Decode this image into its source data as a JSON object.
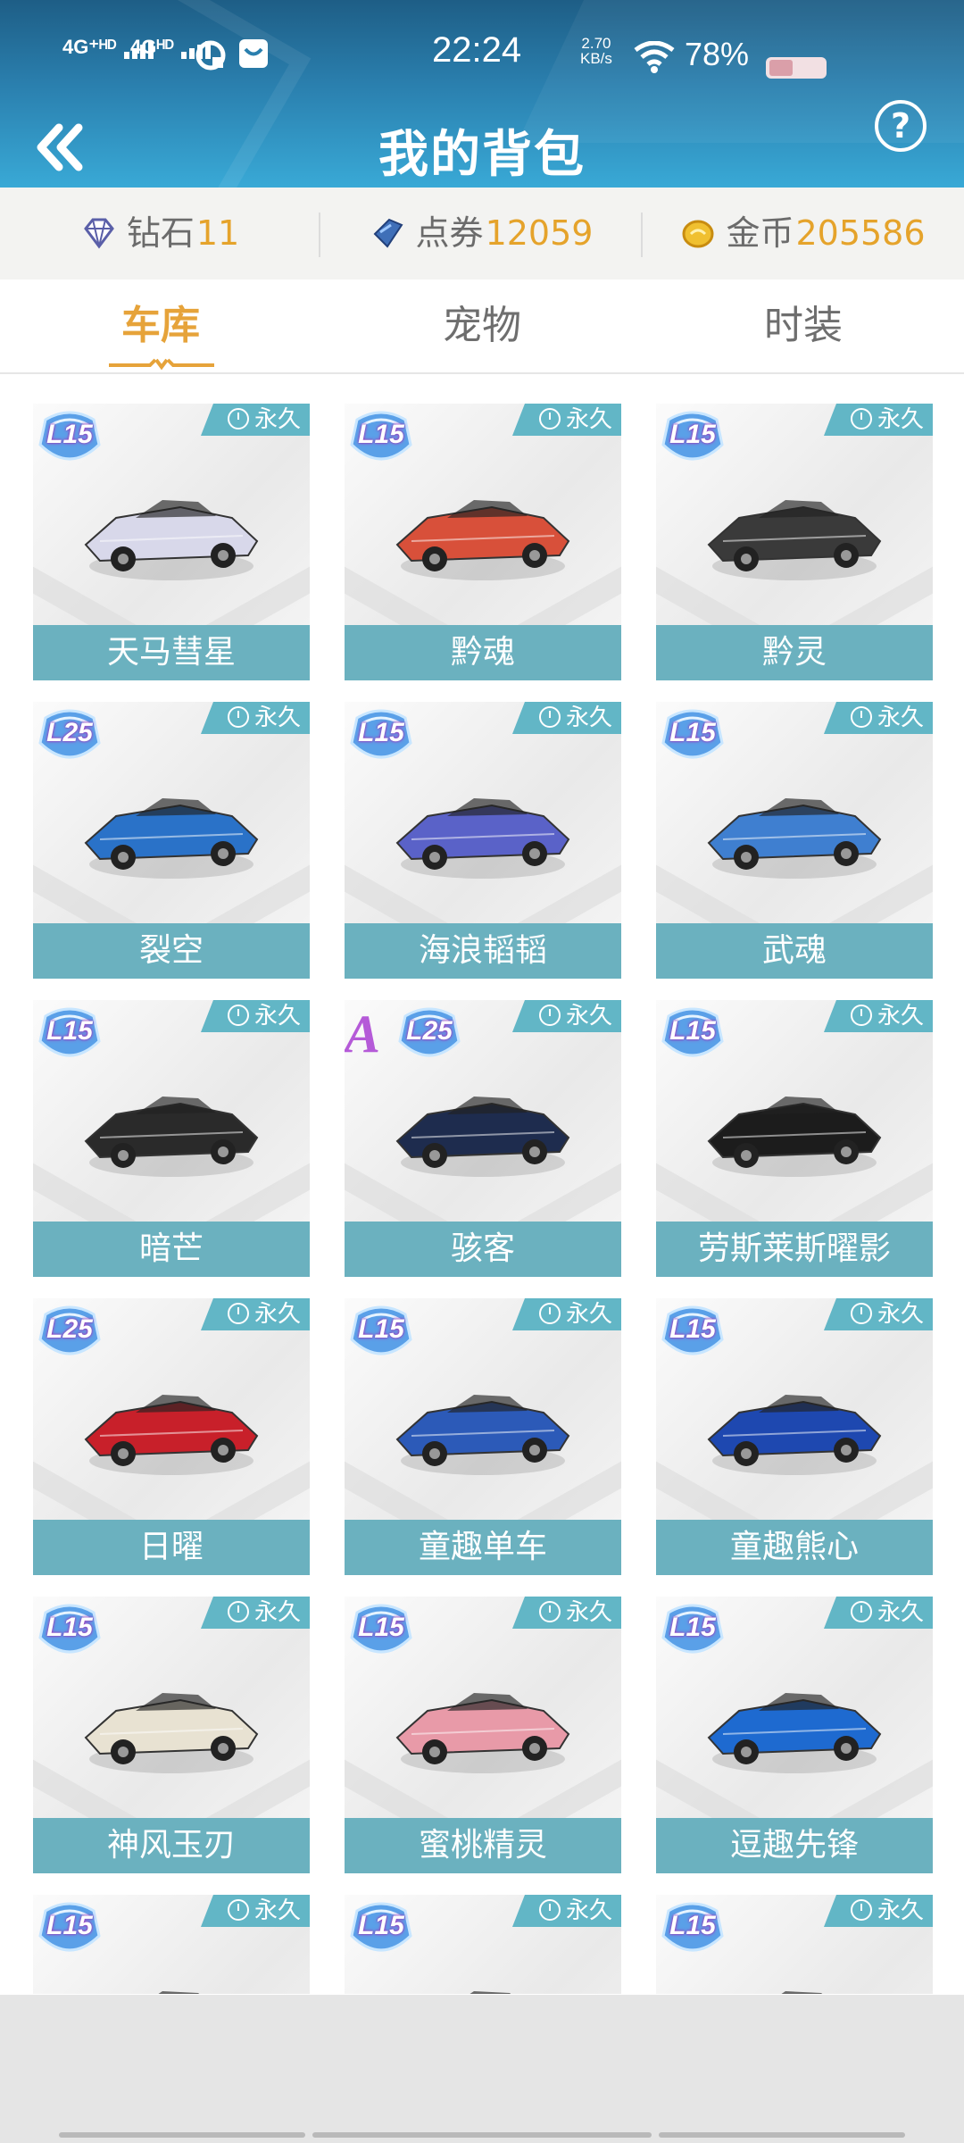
{
  "status": {
    "sig1": "4G⁺ᴴᴰ",
    "sig2": "4Gᴴᴰ",
    "time": "22:24",
    "speed_value": "2.70",
    "speed_unit": "KB/s",
    "battery": "78%"
  },
  "header": {
    "title": "我的背包",
    "help": "?"
  },
  "currency": {
    "diamond_label": "钻石",
    "diamond_value": "11",
    "coupon_label": "点券",
    "coupon_value": "12059",
    "gold_label": "金币",
    "gold_value": "205586"
  },
  "tabs": [
    "车库",
    "宠物",
    "时装"
  ],
  "permanent_label": "永久",
  "cars": [
    {
      "name": "天马彗星",
      "level": "15",
      "color": "#d8d8ea"
    },
    {
      "name": "黔魂",
      "level": "15",
      "color": "#d8503a"
    },
    {
      "name": "黔灵",
      "level": "15",
      "color": "#3a3a3a"
    },
    {
      "name": "裂空",
      "level": "25",
      "color": "#2a72c8"
    },
    {
      "name": "海浪韬韬",
      "level": "15",
      "color": "#5a62c8"
    },
    {
      "name": "武魂",
      "level": "15",
      "color": "#3f7fd0"
    },
    {
      "name": "暗芒",
      "level": "15",
      "color": "#2a2a2a"
    },
    {
      "name": "骇客",
      "level": "25",
      "color": "#1e2c4e"
    },
    {
      "name": "劳斯莱斯曜影",
      "level": "15",
      "color": "#1c1c1c"
    },
    {
      "name": "日曜",
      "level": "25",
      "color": "#c8202a"
    },
    {
      "name": "童趣单车",
      "level": "15",
      "color": "#2c5ab8"
    },
    {
      "name": "童趣熊心",
      "level": "15",
      "color": "#1e48b0"
    },
    {
      "name": "神风玉刃",
      "level": "15",
      "color": "#e8e2d2"
    },
    {
      "name": "蜜桃精灵",
      "level": "15",
      "color": "#e89aa8"
    },
    {
      "name": "逗趣先锋",
      "level": "15",
      "color": "#1e6ad0"
    },
    {
      "name": "",
      "level": "15",
      "color": "#c83030"
    },
    {
      "name": "",
      "level": "15",
      "color": "#d83a3a"
    },
    {
      "name": "",
      "level": "15",
      "color": "#2a2a2a"
    }
  ],
  "special_badge": "A"
}
